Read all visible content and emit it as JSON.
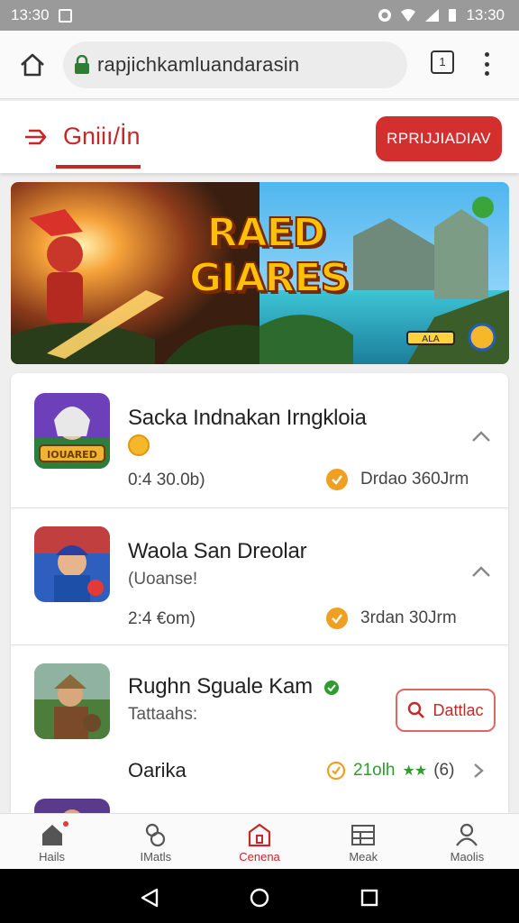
{
  "status_bar": {
    "time_left": "13:30",
    "time_right": "13:30"
  },
  "browser": {
    "url": "rapjichkamluandarasin",
    "url_highlight": "r",
    "tabs_count": "1"
  },
  "header": {
    "brand": "Gniiı/İn",
    "cta_label": "RPRIJJIADIAV"
  },
  "banner": {
    "title_line1": "RAED",
    "title_line2": "GIARES",
    "progress_text": "ALA"
  },
  "games": [
    {
      "title": "Sacka Indnakan Irngkloia",
      "sub": "",
      "meta_left": "0:4 30.0b)",
      "meta_right": "Drdao 360Jrm"
    },
    {
      "title": "Waola San Dreolar",
      "sub": "(Uoanse!",
      "meta_left": "2:4 €om)",
      "meta_right": "3rdan 30Jrm"
    },
    {
      "title": "Rughn Sguale Kam",
      "sub": "Tattaahs:",
      "meta_left": "Oarika",
      "meta_right_value": "21olh",
      "rating_count": "(6)",
      "details_label": "Dattlac"
    }
  ],
  "thumb_labels": {
    "first": "IOUARED"
  },
  "bottom_nav": [
    {
      "label": "Hails",
      "icon": "home-icon"
    },
    {
      "label": "IMatls",
      "icon": "controller-icon"
    },
    {
      "label": "Cenena",
      "icon": "store-icon"
    },
    {
      "label": "Meak",
      "icon": "grid-icon"
    },
    {
      "label": "Maolis",
      "icon": "profile-icon"
    }
  ],
  "colors": {
    "accent": "#d32f2f",
    "rating_green": "#2e9d2e",
    "check_orange": "#f0a020"
  }
}
